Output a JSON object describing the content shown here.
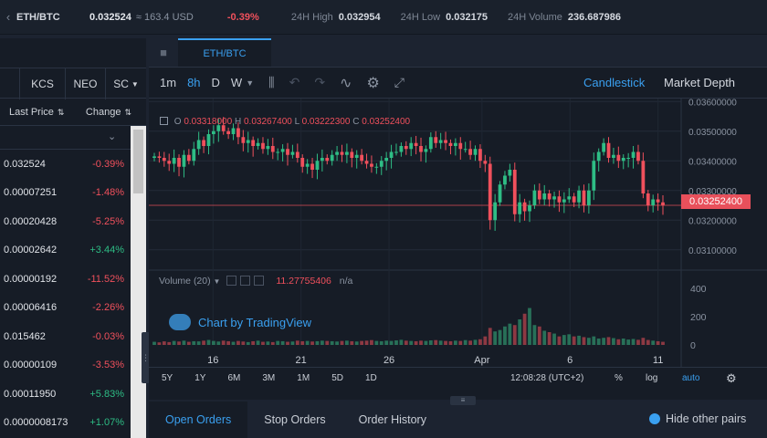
{
  "ticker": {
    "pair": "ETH/BTC",
    "price": "0.032524",
    "usd": "≈ 163.4 USD",
    "change": "-0.39%",
    "high_label": "24H High",
    "high": "0.032954",
    "low_label": "24H Low",
    "low": "0.032175",
    "volume_label": "24H Volume",
    "volume": "236.687986"
  },
  "market": {
    "tabs": [
      "KCS",
      "NEO",
      "SC"
    ],
    "headers": {
      "price": "Last Price",
      "change": "Change"
    },
    "rows": [
      {
        "price": "0.032524",
        "change": "-0.39%",
        "dir": "down"
      },
      {
        "price": "0.00007251",
        "change": "-1.48%",
        "dir": "down"
      },
      {
        "price": "0.00020428",
        "change": "-5.25%",
        "dir": "down"
      },
      {
        "price": "0.00002642",
        "change": "+3.44%",
        "dir": "up"
      },
      {
        "price": "0.00000192",
        "change": "-11.52%",
        "dir": "down"
      },
      {
        "price": "0.00006416",
        "change": "-2.26%",
        "dir": "down"
      },
      {
        "price": "0.015462",
        "change": "-0.03%",
        "dir": "down"
      },
      {
        "price": "0.00000109",
        "change": "-3.53%",
        "dir": "down"
      },
      {
        "price": "0.00011950",
        "change": "+5.83%",
        "dir": "up"
      },
      {
        "price": "0.0000008173",
        "change": "+1.07%",
        "dir": "up"
      }
    ]
  },
  "chart": {
    "tab": "ETH/BTC",
    "intervals": [
      "1m",
      "8h",
      "D",
      "W"
    ],
    "active_interval": "8h",
    "views": {
      "candlestick": "Candlestick",
      "depth": "Market Depth"
    },
    "ohlc": {
      "o_label": "O",
      "o": "0.03318000",
      "h_label": "H",
      "h": "0.03267400",
      "l_label": "L",
      "l": "0.03222300",
      "c_label": "C",
      "c": "0.03252400"
    },
    "volume_label": "Volume (20)",
    "volume_value": "11.27755406",
    "volume_na": "n/a",
    "watermark": "Chart by TradingView",
    "last_price": "0.03252400",
    "timeframes": [
      "5Y",
      "1Y",
      "6M",
      "3M",
      "1M",
      "5D",
      "1D"
    ],
    "time": "12:08:28 (UTC+2)",
    "pct": "%",
    "log": "log",
    "auto": "auto"
  },
  "chart_data": {
    "type": "candlestick",
    "price_axis_ticks": [
      "0.03600000",
      "0.03500000",
      "0.03400000",
      "0.03300000",
      "0.03200000",
      "0.03100000"
    ],
    "price_ylim": [
      0.0305,
      0.0361
    ],
    "volume_axis_ticks": [
      "400",
      "200",
      "0"
    ],
    "volume_ylim": [
      0,
      450
    ],
    "x_ticks": [
      "16",
      "21",
      "26",
      "Apr",
      "6",
      "11"
    ],
    "candles_close": [
      0.03415,
      0.0341,
      0.034,
      0.0339,
      0.0341,
      0.0338,
      0.0342,
      0.034,
      0.0344,
      0.0347,
      0.0345,
      0.0349,
      0.035,
      0.0352,
      0.035,
      0.0349,
      0.0351,
      0.0348,
      0.0346,
      0.0347,
      0.0345,
      0.0346,
      0.0344,
      0.0345,
      0.0343,
      0.0343,
      0.0344,
      0.0342,
      0.0343,
      0.0341,
      0.0338,
      0.0339,
      0.0337,
      0.034,
      0.0341,
      0.034,
      0.0342,
      0.0343,
      0.0342,
      0.0343,
      0.0341,
      0.0342,
      0.034,
      0.0339,
      0.0338,
      0.0338,
      0.034,
      0.0341,
      0.0343,
      0.0343,
      0.0345,
      0.0344,
      0.0346,
      0.0345,
      0.0343,
      0.0344,
      0.0348,
      0.0346,
      0.0347,
      0.0346,
      0.0345,
      0.0346,
      0.0344,
      0.0344,
      0.0342,
      0.0344,
      0.034,
      0.0339,
      0.032,
      0.0326,
      0.0332,
      0.0335,
      0.0337,
      0.0322,
      0.0326,
      0.0323,
      0.0325,
      0.033,
      0.0327,
      0.0329,
      0.0327,
      0.0328,
      0.0326,
      0.0327,
      0.0328,
      0.0326,
      0.033,
      0.0325,
      0.033,
      0.034,
      0.0343,
      0.0346,
      0.0341,
      0.0342,
      0.034,
      0.0341,
      0.0341,
      0.0343,
      0.034,
      0.0329,
      0.0325,
      0.0327,
      0.0326,
      0.0325
    ],
    "volumes": [
      22,
      18,
      25,
      20,
      28,
      24,
      30,
      22,
      26,
      25,
      30,
      35,
      28,
      24,
      30,
      26,
      22,
      28,
      24,
      20,
      26,
      30,
      22,
      24,
      20,
      28,
      26,
      22,
      24,
      30,
      26,
      28,
      24,
      26,
      30,
      28,
      26,
      24,
      28,
      30,
      26,
      24,
      28,
      30,
      34,
      28,
      26,
      30,
      28,
      32,
      36,
      30,
      28,
      26,
      30,
      28,
      32,
      34,
      30,
      28,
      26,
      30,
      28,
      34,
      30,
      36,
      40,
      60,
      120,
      95,
      105,
      130,
      150,
      140,
      180,
      220,
      260,
      140,
      130,
      100,
      90,
      80,
      60,
      70,
      75,
      60,
      65,
      55,
      50,
      60,
      45,
      50,
      55,
      48,
      40,
      45,
      38,
      42,
      36,
      50,
      35,
      30,
      26,
      22
    ]
  }
}
